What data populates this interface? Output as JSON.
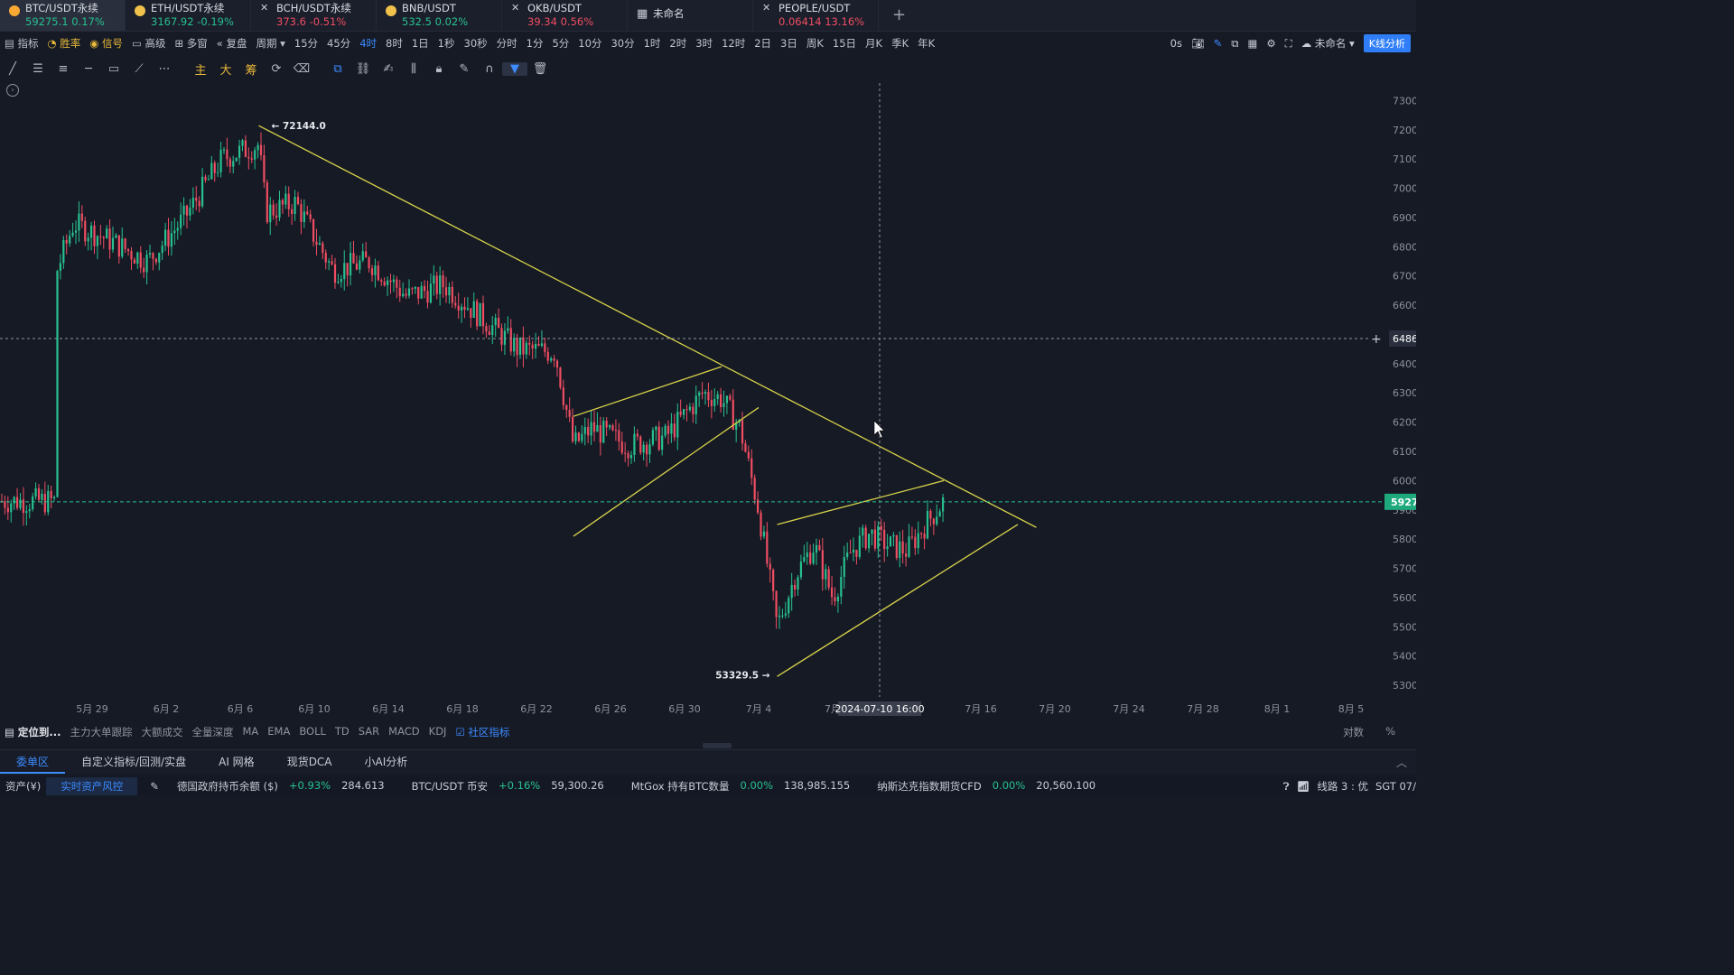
{
  "tabs": [
    {
      "name": "BTC/USDT永续",
      "price": "59275.1",
      "change": "0.17%",
      "dir": "up",
      "icon": "btc-coin-icon",
      "color": "#f7a934",
      "active": true
    },
    {
      "name": "ETH/USDT永续",
      "price": "3167.92",
      "change": "-0.19%",
      "dir": "up",
      "icon": "eth-coin-icon",
      "color": "#f0c14b"
    },
    {
      "name": "BCH/USDT永续",
      "price": "373.6",
      "change": "-0.51%",
      "dir": "dn",
      "icon": "close-icon"
    },
    {
      "name": "BNB/USDT",
      "price": "532.5",
      "change": "0.02%",
      "dir": "up",
      "icon": "bnb-coin-icon",
      "color": "#f0c14b"
    },
    {
      "name": "OKB/USDT",
      "price": "39.34",
      "change": "0.56%",
      "dir": "dn",
      "icon": "close-icon"
    },
    {
      "name": "未命名",
      "price": "",
      "change": "",
      "dir": "up",
      "icon": "grid-icon"
    },
    {
      "name": "PEOPLE/USDT",
      "price": "0.06414",
      "change": "13.16%",
      "dir": "dn",
      "icon": "close-icon"
    }
  ],
  "toolbar": {
    "left": [
      "指标",
      "胜率",
      "信号",
      "高级",
      "多窗",
      "复盘",
      "周期"
    ],
    "periods": [
      "15分",
      "45分",
      "4时",
      "8时",
      "1日",
      "1秒",
      "30秒",
      "分时",
      "1分",
      "5分",
      "10分",
      "30分",
      "1时",
      "2时",
      "3时",
      "12时",
      "2日",
      "3日",
      "周K",
      "15日",
      "月K",
      "季K",
      "年K"
    ],
    "active_period": "4时",
    "countdown": "0s",
    "layout_name": "未命名",
    "analysis_button": "K线分析"
  },
  "drawing_tools": {
    "text_tools": [
      "主",
      "大",
      "筹"
    ]
  },
  "chart_data": {
    "type": "candlestick",
    "symbol": "BTC/USDT永续",
    "interval": "4时",
    "x_ticks": [
      "5月 29",
      "6月 2",
      "6月 6",
      "6月 10",
      "6月 14",
      "6月 18",
      "6月 22",
      "6月 26",
      "6月 30",
      "7月 4",
      "7月",
      "7月 16",
      "7月 20",
      "7月 24",
      "7月 28",
      "8月 1",
      "8月 5"
    ],
    "y_ticks": [
      "7300",
      "7200",
      "7100",
      "7000",
      "6900",
      "6800",
      "6700",
      "6600",
      "6500",
      "6400",
      "6300",
      "6200",
      "6100",
      "6000",
      "5900",
      "5800",
      "5700",
      "5600",
      "5500",
      "5400",
      "5300"
    ],
    "ylim": [
      52600,
      73600
    ],
    "high_annotation": "72144.0",
    "low_annotation": "53329.5",
    "crosshair_time": "2024-07-10 16:00",
    "crosshair_price": "6486",
    "last_price_tag": "5927",
    "last_price": 59275.1,
    "trendlines": [
      {
        "name": "descending-resistance",
        "from": {
          "date": "2024-06-07",
          "price": 72144
        },
        "to": {
          "date": "2024-07-19",
          "price": 58400
        }
      },
      {
        "name": "wedge1-upper",
        "from": {
          "date": "2024-06-24",
          "price": 62200
        },
        "to": {
          "date": "2024-07-02",
          "price": 63900
        }
      },
      {
        "name": "wedge1-lower",
        "from": {
          "date": "2024-06-24",
          "price": 58100
        },
        "to": {
          "date": "2024-07-04",
          "price": 62500
        }
      },
      {
        "name": "triangle-upper",
        "from": {
          "date": "2024-07-05",
          "price": 58500
        },
        "to": {
          "date": "2024-07-14",
          "price": 60000
        }
      },
      {
        "name": "triangle-lower",
        "from": {
          "date": "2024-07-05",
          "price": 53300
        },
        "to": {
          "date": "2024-07-18",
          "price": 58500
        }
      }
    ]
  },
  "indicators": {
    "locate": "定位到...",
    "items": [
      "主力大单跟踪",
      "大额成交",
      "全量深度",
      "MA",
      "EMA",
      "BOLL",
      "TD",
      "SAR",
      "MACD",
      "KDJ"
    ],
    "community": "社区指标",
    "right": [
      "对数",
      "%"
    ]
  },
  "bottom_tabs": [
    "委单区",
    "自定义指标/回测/实盘",
    "AI 网格",
    "现货DCA",
    "小AI分析"
  ],
  "status": {
    "assets": "资产(¥)",
    "risk": "实时资产风控",
    "tickers": [
      {
        "name": "德国政府持币余额 ($)",
        "change": "+0.93%",
        "value": "284.613"
      },
      {
        "name": "BTC/USDT 币安",
        "change": "+0.16%",
        "value": "59,300.26"
      },
      {
        "name": "MtGox 持有BTC数量",
        "change": "0.00%",
        "value": "138,985.155"
      },
      {
        "name": "纳斯达克指数期货CFD",
        "change": "0.00%",
        "value": "20,560.100"
      }
    ],
    "line": "线路 3 : 优",
    "tz": "SGT 07/"
  }
}
